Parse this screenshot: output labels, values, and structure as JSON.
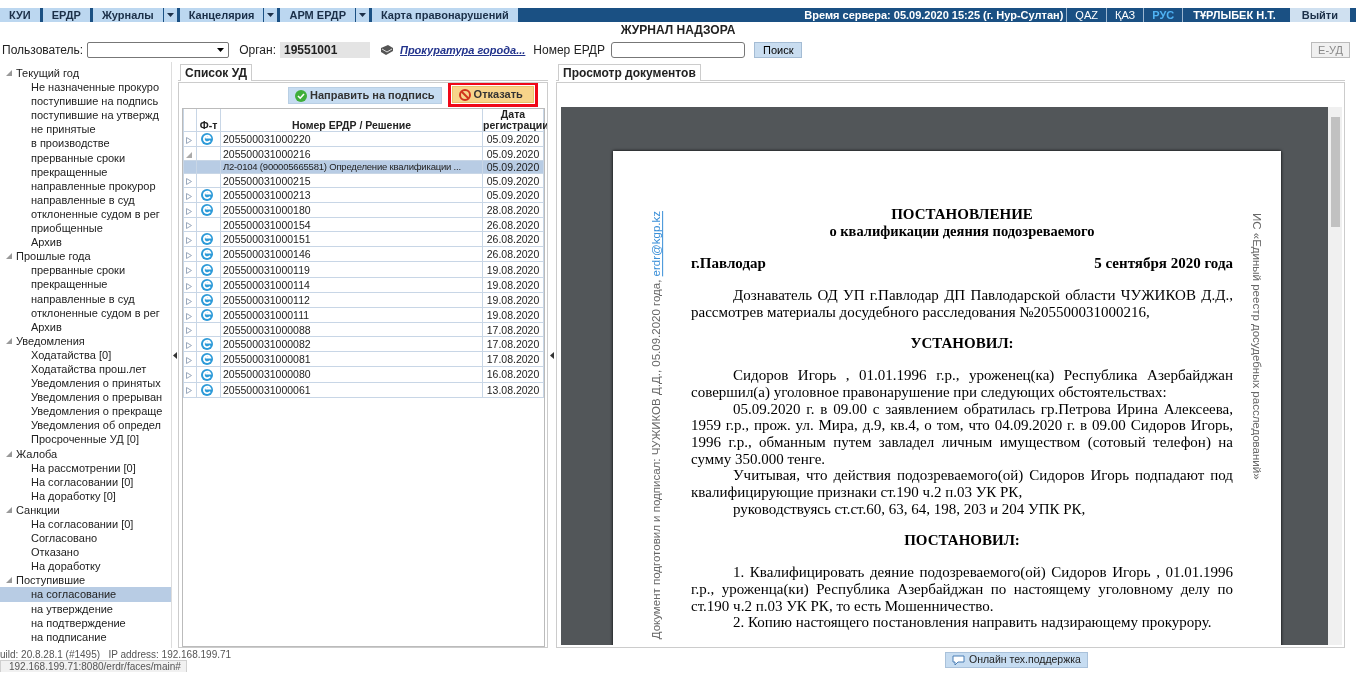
{
  "top_nav": {
    "tabs": [
      {
        "label": "КУИ",
        "dropdown": false
      },
      {
        "label": "ЕРДР",
        "dropdown": false
      },
      {
        "label": "Журналы",
        "dropdown": true
      },
      {
        "label": "Канцелярия",
        "dropdown": true
      },
      {
        "label": "АРМ ЕРДР",
        "dropdown": true
      },
      {
        "label": "Карта правонарушений",
        "dropdown": false
      }
    ],
    "server_time": "Время сервера: 05.09.2020 15:25 (г. Нур-Султан)",
    "languages": [
      {
        "label": "QAZ",
        "selected": false
      },
      {
        "label": "ҚАЗ",
        "selected": false
      },
      {
        "label": "РУС",
        "selected": true
      }
    ],
    "user": "ТҰРЛЫБЕК Н.Т.",
    "logout": "Выйти"
  },
  "title": "ЖУРНАЛ НАДЗОРА",
  "filters": {
    "user_label": "Пользователь:",
    "organ_label": "Орган:",
    "organ_value": "19551001",
    "organ_name": "Прокуратура города...",
    "erdr_label": "Номер ЕРДР",
    "search_button": "Поиск",
    "eud_button": {
      "label": "Е-УД",
      "disabled": true
    }
  },
  "tree": [
    {
      "label": "Текущий год",
      "expanded": true,
      "children": [
        {
          "label": "Не назначенные прокуро",
          "selected": false
        },
        {
          "label": "поступившие на подпись",
          "selected": false
        },
        {
          "label": "поступившие на утвержд",
          "selected": false
        },
        {
          "label": "не принятые",
          "selected": false
        },
        {
          "label": "в производстве",
          "selected": false
        },
        {
          "label": "прерванные сроки",
          "selected": false
        },
        {
          "label": "прекращенные",
          "selected": false
        },
        {
          "label": "направленные прокурор",
          "selected": false
        },
        {
          "label": "направленные в суд",
          "selected": false
        },
        {
          "label": "отклоненные судом в рег",
          "selected": false
        },
        {
          "label": "приобщенные",
          "selected": false
        },
        {
          "label": "Архив",
          "selected": false
        }
      ]
    },
    {
      "label": "Прошлые года",
      "expanded": true,
      "children": [
        {
          "label": "прерванные сроки",
          "selected": false
        },
        {
          "label": "прекращенные",
          "selected": false
        },
        {
          "label": "направленные в суд",
          "selected": false
        },
        {
          "label": "отклоненные судом в рег",
          "selected": false
        },
        {
          "label": "Архив",
          "selected": false
        }
      ]
    },
    {
      "label": "Уведомления",
      "expanded": true,
      "children": [
        {
          "label": "Ходатайства [0]",
          "selected": false
        },
        {
          "label": "Ходатайства прош.лет",
          "selected": false
        },
        {
          "label": "Уведомления о принятых",
          "selected": false
        },
        {
          "label": "Уведомления о прерыван",
          "selected": false
        },
        {
          "label": "Уведомления о прекраще",
          "selected": false
        },
        {
          "label": "Уведомления об определ",
          "selected": false
        },
        {
          "label": "Просроченные УД [0]",
          "selected": false
        }
      ]
    },
    {
      "label": "Жалоба",
      "expanded": true,
      "children": [
        {
          "label": "На рассмотрении [0]",
          "selected": false
        },
        {
          "label": "На согласовании [0]",
          "selected": false
        },
        {
          "label": "На доработку [0]",
          "selected": false
        }
      ]
    },
    {
      "label": "Санкции",
      "expanded": true,
      "children": [
        {
          "label": "На согласовании [0]",
          "selected": false
        },
        {
          "label": "Согласовано",
          "selected": false
        },
        {
          "label": "Отказано",
          "selected": false
        },
        {
          "label": "На доработку",
          "selected": false
        }
      ]
    },
    {
      "label": "Поступившие",
      "expanded": true,
      "children": [
        {
          "label": "на согласование",
          "selected": true
        },
        {
          "label": "на утверждение",
          "selected": false
        },
        {
          "label": "на подтверждение",
          "selected": false
        },
        {
          "label": "на подписание",
          "selected": false
        }
      ]
    }
  ],
  "case_list": {
    "tab": "Список УД",
    "buttons": [
      {
        "label": "Направить на подпись",
        "kind": "approve"
      },
      {
        "label": "Отказать",
        "kind": "reject"
      }
    ],
    "columns": [
      "Ф-т",
      "Номер ЕРДР / Решение",
      "Дата регистрации"
    ],
    "rows": [
      {
        "number": "205500031000220",
        "date": "05.09.2020",
        "has_icon": true,
        "expanded": false,
        "selected": false
      },
      {
        "number": "205500031000216",
        "date": "05.09.2020",
        "has_icon": false,
        "expanded": true,
        "selected": false,
        "children": [
          {
            "text": "Л2-0104 (900005665581) Определение квалификации ...",
            "date": "05.09.2020",
            "selected": true
          }
        ]
      },
      {
        "number": "205500031000215",
        "date": "05.09.2020",
        "has_icon": false,
        "expanded": false,
        "selected": false
      },
      {
        "number": "205500031000213",
        "date": "05.09.2020",
        "has_icon": true,
        "expanded": false,
        "selected": false
      },
      {
        "number": "205500031000180",
        "date": "28.08.2020",
        "has_icon": true,
        "expanded": false,
        "selected": false
      },
      {
        "number": "205500031000154",
        "date": "26.08.2020",
        "has_icon": false,
        "expanded": false,
        "selected": false
      },
      {
        "number": "205500031000151",
        "date": "26.08.2020",
        "has_icon": true,
        "expanded": false,
        "selected": false
      },
      {
        "number": "205500031000146",
        "date": "26.08.2020",
        "has_icon": true,
        "expanded": false,
        "selected": false
      },
      {
        "number": "205500031000119",
        "date": "19.08.2020",
        "has_icon": true,
        "expanded": false,
        "selected": false
      },
      {
        "number": "205500031000114",
        "date": "19.08.2020",
        "has_icon": true,
        "expanded": false,
        "selected": false
      },
      {
        "number": "205500031000112",
        "date": "19.08.2020",
        "has_icon": true,
        "expanded": false,
        "selected": false
      },
      {
        "number": "205500031000111",
        "date": "19.08.2020",
        "has_icon": true,
        "expanded": false,
        "selected": false
      },
      {
        "number": "205500031000088",
        "date": "17.08.2020",
        "has_icon": false,
        "expanded": false,
        "selected": false
      },
      {
        "number": "205500031000082",
        "date": "17.08.2020",
        "has_icon": true,
        "expanded": false,
        "selected": false
      },
      {
        "number": "205500031000081",
        "date": "17.08.2020",
        "has_icon": true,
        "expanded": false,
        "selected": false
      },
      {
        "number": "205500031000080",
        "date": "16.08.2020",
        "has_icon": true,
        "expanded": false,
        "selected": false
      },
      {
        "number": "205500031000061",
        "date": "13.08.2020",
        "has_icon": true,
        "expanded": false,
        "selected": false
      }
    ]
  },
  "viewer": {
    "tab": "Просмотр документов",
    "document": {
      "side_note": "Документ подготовил и подписал: ЧУЖИКОВ Д.Д., 05.09.2020 года,",
      "side_link": "erdr@kgp.kz",
      "side_note_right": "ИС «Единый реестр досудебных расследований»",
      "blocks": [
        {
          "kind": "title",
          "text": "ПОСТАНОВЛЕНИЕ"
        },
        {
          "kind": "subtitle",
          "text": "о квалификации деяния подозреваемого"
        },
        {
          "kind": "place_date",
          "left": "г.Павлодар",
          "right": "5 сентября 2020 года"
        },
        {
          "kind": "paragraph",
          "text": "Дознаватель ОД УП г.Павлодар ДП Павлодарской области ЧУЖИКОВ Д.Д., рассмотрев материалы досудебного расследования №205500031000216,"
        },
        {
          "kind": "heading",
          "text": "УСТАНОВИЛ:"
        },
        {
          "kind": "paragraph",
          "text": "Сидоров Игорь , 01.01.1996 г.р., уроженец(ка) Республика Азербайджан совершил(а) уголовное правонарушение при следующих обстоятельствах:"
        },
        {
          "kind": "paragraph",
          "text": "05.09.2020 г. в 09.00 с заявлением обратилась гр.Петрова Ирина Алексеева, 1959 г.р., прож. ул. Мира, д.9, кв.4, о том, что 04.09.2020 г. в 09.00 Сидоров Игорь, 1996 г.р., обманным путем завладел личным имуществом (сотовый телефон) на сумму 350.000 тенге."
        },
        {
          "kind": "paragraph",
          "text": "Учитывая, что действия подозреваемого(ой) Сидоров Игорь подпадают под квалифицирующие признаки ст.190 ч.2 п.03 УК РК,"
        },
        {
          "kind": "paragraph",
          "text": "руководствуясь ст.ст.60, 63, 64, 198, 203 и 204 УПК РК,"
        },
        {
          "kind": "heading",
          "text": "ПОСТАНОВИЛ:"
        },
        {
          "kind": "paragraph",
          "text": "1. Квалифицировать деяние подозреваемого(ой) Сидоров Игорь , 01.01.1996 г.р., уроженца(ки) Республика Азербайджан по настоящему уголовному делу по ст.190 ч.2 п.03 УК РК, то есть Мошенничество."
        },
        {
          "kind": "paragraph",
          "text": "2. Копию настоящего постановления направить надзирающему прокурору."
        }
      ]
    }
  },
  "footer": {
    "build": "uild: 20.8.28.1 (#1495)   IP address: 192.168.199.71",
    "support_button": "Онлайн тех.поддержка",
    "status_url": "192.168.199.71:8080/erdr/faces/main#"
  }
}
